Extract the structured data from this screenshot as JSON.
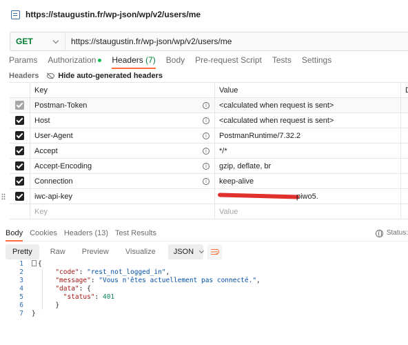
{
  "window": {
    "title": "https://staugustin.fr/wp-json/wp/v2/users/me",
    "icon": "http-request-icon"
  },
  "request": {
    "method": "GET",
    "url": "https://staugustin.fr/wp-json/wp/v2/users/me"
  },
  "request_tabs": [
    {
      "label": "Params"
    },
    {
      "label": "Authorization",
      "indicator": "green-dot"
    },
    {
      "label": "Headers",
      "count": "(7)",
      "active": true
    },
    {
      "label": "Body"
    },
    {
      "label": "Pre-request Script"
    },
    {
      "label": "Tests"
    },
    {
      "label": "Settings"
    }
  ],
  "headers_section": {
    "label": "Headers",
    "hide_button": "Hide auto-generated headers"
  },
  "headers_table": {
    "columns": {
      "key": "Key",
      "value": "Value",
      "desc": "D"
    },
    "rows": [
      {
        "key": "Postman-Token",
        "value": "<calculated when request is sent>",
        "checked": true,
        "auto": true
      },
      {
        "key": "Host",
        "value": "<calculated when request is sent>",
        "checked": true,
        "auto": true
      },
      {
        "key": "User-Agent",
        "value": "PostmanRuntime/7.32.2",
        "checked": true,
        "auto": true
      },
      {
        "key": "Accept",
        "value": "*/*",
        "checked": true,
        "auto": true
      },
      {
        "key": "Accept-Encoding",
        "value": "gzip, deflate, br",
        "checked": true,
        "auto": true
      },
      {
        "key": "Connection",
        "value": "keep-alive",
        "checked": true,
        "auto": true
      },
      {
        "key": "iwc-api-key",
        "value_visible_tail": "piwo5.",
        "checked": true,
        "auto": false,
        "value_redacted": true
      }
    ],
    "new_row": {
      "key_placeholder": "Key",
      "value_placeholder": "Value"
    }
  },
  "response_tabs": [
    {
      "label": "Body",
      "active": true
    },
    {
      "label": "Cookies"
    },
    {
      "label": "Headers",
      "count": "(13)"
    },
    {
      "label": "Test Results"
    }
  ],
  "response_status": {
    "label": "Status:",
    "icon": "globe-icon"
  },
  "format_bar": {
    "options": [
      "Pretty",
      "Raw",
      "Preview",
      "Visualize"
    ],
    "active": "Pretty",
    "language": "JSON",
    "wrap_icon": "wrap-lines-icon"
  },
  "response_body": {
    "line_numbers": [
      "1",
      "2",
      "3",
      "4",
      "5",
      "6",
      "7"
    ],
    "open_brace": "{",
    "code_key": "\"code\"",
    "code_value": "\"rest_not_logged_in\"",
    "message_key": "\"message\"",
    "message_value": "\"Vous n'êtes actuellement pas connecté.\"",
    "data_key": "\"data\"",
    "status_key": "\"status\"",
    "status_value": "401",
    "close_inner": "}",
    "close_brace": "}"
  }
}
